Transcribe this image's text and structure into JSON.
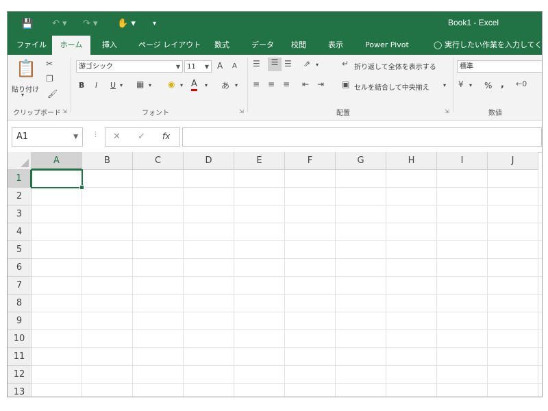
{
  "title_bar": {
    "title": "Book1 - Excel",
    "icons": [
      "save-icon",
      "undo-icon",
      "redo-icon",
      "touch-mode-icon",
      "customize-qat-icon"
    ]
  },
  "tabs": [
    {
      "label": "ファイル",
      "active": false
    },
    {
      "label": "ホーム",
      "active": true
    },
    {
      "label": "挿入",
      "active": false
    },
    {
      "label": "ページ レイアウト",
      "active": false
    },
    {
      "label": "数式",
      "active": false
    },
    {
      "label": "データ",
      "active": false
    },
    {
      "label": "校閲",
      "active": false
    },
    {
      "label": "表示",
      "active": false
    },
    {
      "label": "Power Pivot",
      "active": false
    }
  ],
  "tell_me": "実行したい作業を入力してく",
  "ribbon": {
    "clipboard": {
      "paste_label": "貼り付け",
      "group_label": "クリップボード"
    },
    "font": {
      "font_name": "游ゴシック",
      "font_size": "11",
      "group_label": "フォント",
      "bold": "B",
      "italic": "I",
      "underline": "U",
      "grow": "A",
      "shrink": "A",
      "font_color": "A"
    },
    "alignment": {
      "wrap_text": "折り返して全体を表示する",
      "merge_center": "セルを結合して中央揃え",
      "group_label": "配置"
    },
    "number": {
      "format": "標準",
      "percent": "%",
      "comma": ",",
      "group_label": "数値"
    }
  },
  "formula_bar": {
    "name_box": "A1",
    "fx": "fx",
    "formula": ""
  },
  "sheet": {
    "columns": [
      "A",
      "B",
      "C",
      "D",
      "E",
      "F",
      "G",
      "H",
      "I",
      "J"
    ],
    "rows": [
      "1",
      "2",
      "3",
      "4",
      "5",
      "6",
      "7",
      "8",
      "9",
      "10",
      "11",
      "12",
      "13"
    ],
    "active_cell": "A1"
  },
  "colors": {
    "accent": "#217346",
    "ribbon_bg": "#f3f3f3",
    "gridline": "#e1e1e1"
  }
}
